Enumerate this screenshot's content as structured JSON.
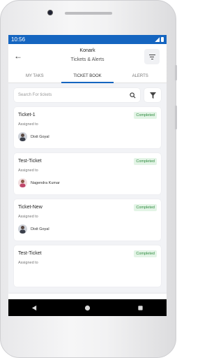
{
  "status": {
    "time": "10:56"
  },
  "header": {
    "title": "Konark",
    "subtitle": "Tickets & Alerts"
  },
  "tabs": [
    {
      "label": "MY TAKS"
    },
    {
      "label": "TICKET BOOK"
    },
    {
      "label": "ALERTS"
    }
  ],
  "search": {
    "placeholder": "Search For tickets"
  },
  "tickets": [
    {
      "title": "Ticket-1",
      "status": "Completed",
      "assigned_label": "Assigned to",
      "assignee": "Dixit Goyal"
    },
    {
      "title": "Test-Ticket",
      "status": "Completed",
      "assigned_label": "Assigned to",
      "assignee": "Nagendra Kumar"
    },
    {
      "title": "Ticket-New",
      "status": "Completed",
      "assigned_label": "Assigned to",
      "assignee": "Dixit Goyal"
    },
    {
      "title": "Test-Ticket",
      "status": "Completed",
      "assigned_label": "Assigned to",
      "assignee": ""
    }
  ],
  "bottom_nav": [
    {
      "icon": "home-icon"
    },
    {
      "icon": "bell-icon"
    },
    {
      "icon": "person-icon"
    }
  ],
  "colors": {
    "primary": "#1565c0",
    "badge_bg": "#e3f4e6",
    "badge_text": "#2e8b3e"
  }
}
